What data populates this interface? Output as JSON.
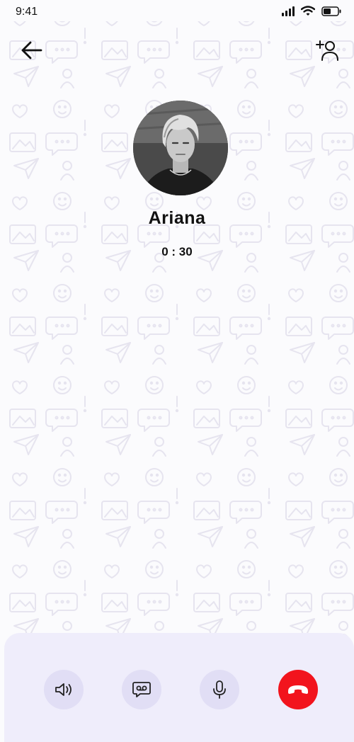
{
  "status_bar": {
    "time": "9:41"
  },
  "header": {
    "back_icon": "arrow-left-icon",
    "add_person_icon": "add-person-icon"
  },
  "caller": {
    "name": "Ariana",
    "call_duration": "0 : 30"
  },
  "controls": [
    {
      "name": "speaker",
      "icon": "speaker-icon"
    },
    {
      "name": "voicemail",
      "icon": "voicemail-icon"
    },
    {
      "name": "microphone",
      "icon": "microphone-icon"
    },
    {
      "name": "end-call",
      "icon": "end-call-icon",
      "color": "#f2141d"
    }
  ],
  "colors": {
    "panel_background": "#efedfb",
    "button_background": "#e1def5",
    "end_call": "#f2141d",
    "wallpaper_doodle": "#e6e4ef"
  }
}
